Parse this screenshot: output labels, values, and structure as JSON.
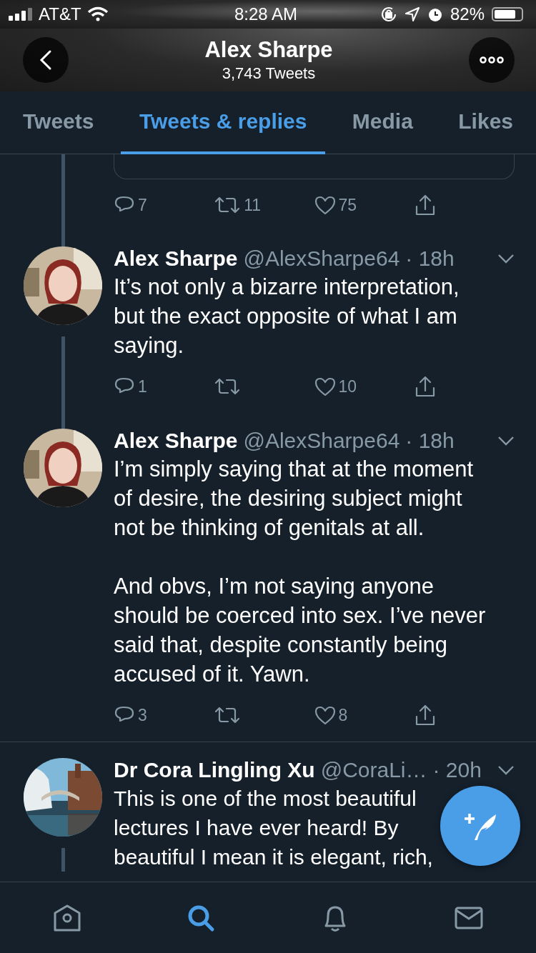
{
  "status_bar": {
    "carrier": "AT&T",
    "time": "8:28 AM",
    "battery": "82%"
  },
  "header": {
    "title": "Alex Sharpe",
    "subtitle": "3,743 Tweets"
  },
  "tabs": [
    {
      "label": "Tweets",
      "selected": false
    },
    {
      "label": "Tweets & replies",
      "selected": true
    },
    {
      "label": "Media",
      "selected": false
    },
    {
      "label": "Likes",
      "selected": false
    }
  ],
  "feed": [
    {
      "kind": "quote_tail",
      "actions": {
        "replies": "7",
        "retweets": "11",
        "likes": "75"
      }
    },
    {
      "kind": "tweet",
      "thread_above": true,
      "thread_below": true,
      "name": "Alex Sharpe",
      "handle": "@AlexSharpe64",
      "time": "· 18h",
      "text": "It’s not only a bizarre interpretation, but the exact opposite of what I am saying.",
      "actions": {
        "replies": "1",
        "likes": "10"
      }
    },
    {
      "kind": "tweet",
      "thread_above": true,
      "thread_below": false,
      "name": "Alex Sharpe",
      "handle": "@AlexSharpe64",
      "time": "· 18h",
      "text": "I’m simply saying that at the moment of desire, the desiring subject might not be thinking of genitals at all.\n\nAnd obvs, I’m not saying anyone should be coerced into sex. I’ve never said that, despite constantly being accused of it. Yawn.",
      "actions": {
        "replies": "3",
        "likes": "8"
      }
    },
    {
      "kind": "tweet",
      "thread_above": false,
      "thread_below": true,
      "name": "Dr Cora Lingling Xu",
      "handle": "@CoraLi…",
      "time": "· 20h",
      "text": "This is one of the most beautiful lectures I have ever heard! By beautiful I mean it is elegant, rich,"
    }
  ],
  "bottom_nav": [
    {
      "kind": "home",
      "selected": false
    },
    {
      "kind": "search",
      "selected": true
    },
    {
      "kind": "notifications",
      "selected": false
    },
    {
      "kind": "messages",
      "selected": false
    }
  ]
}
